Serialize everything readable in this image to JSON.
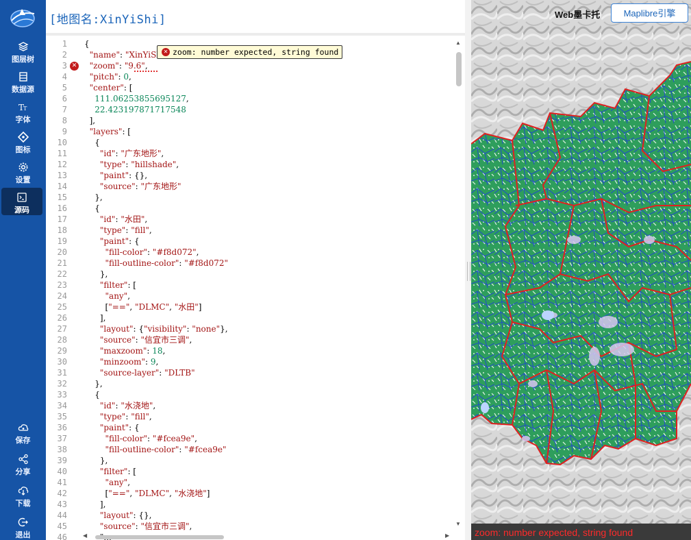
{
  "colors": {
    "sidebar": "#1654a6",
    "active_nav": "#0d2f5e",
    "title": "#1a64b9",
    "error": "#ff2a2a",
    "terrain_green": "#2e9e5c",
    "boundary_red": "#e02020",
    "boundary_blue": "#1e3cdc"
  },
  "sidebar": {
    "top_items": [
      {
        "label": "图层树",
        "icon": "layers-icon"
      },
      {
        "label": "数据源",
        "icon": "database-icon"
      },
      {
        "label": "字体",
        "icon": "font-icon"
      },
      {
        "label": "图标",
        "icon": "diamond-icon"
      },
      {
        "label": "设置",
        "icon": "gear-icon"
      },
      {
        "label": "源码",
        "icon": "terminal-icon",
        "active": true
      }
    ],
    "bottom_items": [
      {
        "label": "保存",
        "icon": "cloud-save-icon"
      },
      {
        "label": "分享",
        "icon": "share-icon"
      },
      {
        "label": "下载",
        "icon": "cloud-download-icon"
      },
      {
        "label": "退出",
        "icon": "logout-icon"
      }
    ]
  },
  "editor": {
    "title": "[地图名:XinYiShi]",
    "error_tooltip": "zoom: number expected, string found",
    "error_line": 3,
    "lines": [
      "{",
      "  \"name\": \"XinYiShi\",",
      "  \"zoom\": \"9.6\",",
      "  \"pitch\": 0,",
      "  \"center\": [",
      "    111.06253855695127,",
      "    22.423197871717548",
      "  ],",
      "  \"layers\": [",
      "    {",
      "      \"id\": \"广东地形\",",
      "      \"type\": \"hillshade\",",
      "      \"paint\": {},",
      "      \"source\": \"广东地形\"",
      "    },",
      "    {",
      "      \"id\": \"水田\",",
      "      \"type\": \"fill\",",
      "      \"paint\": {",
      "        \"fill-color\": \"#f8d072\",",
      "        \"fill-outline-color\": \"#f8d072\"",
      "      },",
      "      \"filter\": [",
      "        \"any\",",
      "        [\"==\", \"DLMC\", \"水田\"]",
      "      ],",
      "      \"layout\": {\"visibility\": \"none\"},",
      "      \"source\": \"信宜市三调\",",
      "      \"maxzoom\": 18,",
      "      \"minzoom\": 9,",
      "      \"source-layer\": \"DLTB\"",
      "    },",
      "    {",
      "      \"id\": \"水浇地\",",
      "      \"type\": \"fill\",",
      "      \"paint\": {",
      "        \"fill-color\": \"#fcea9e\",",
      "        \"fill-outline-color\": \"#fcea9e\"",
      "      },",
      "      \"filter\": [",
      "        \"any\",",
      "        [\"==\", \"DLMC\", \"水浇地\"]",
      "      ],",
      "      \"layout\": {},",
      "      \"source\": \"信宜市三调\",",
      "      \"..."
    ]
  },
  "map": {
    "label": "Web墨卡托",
    "engine_button": "Maplibre引擎",
    "error_text": "zoom: number expected, string found"
  }
}
